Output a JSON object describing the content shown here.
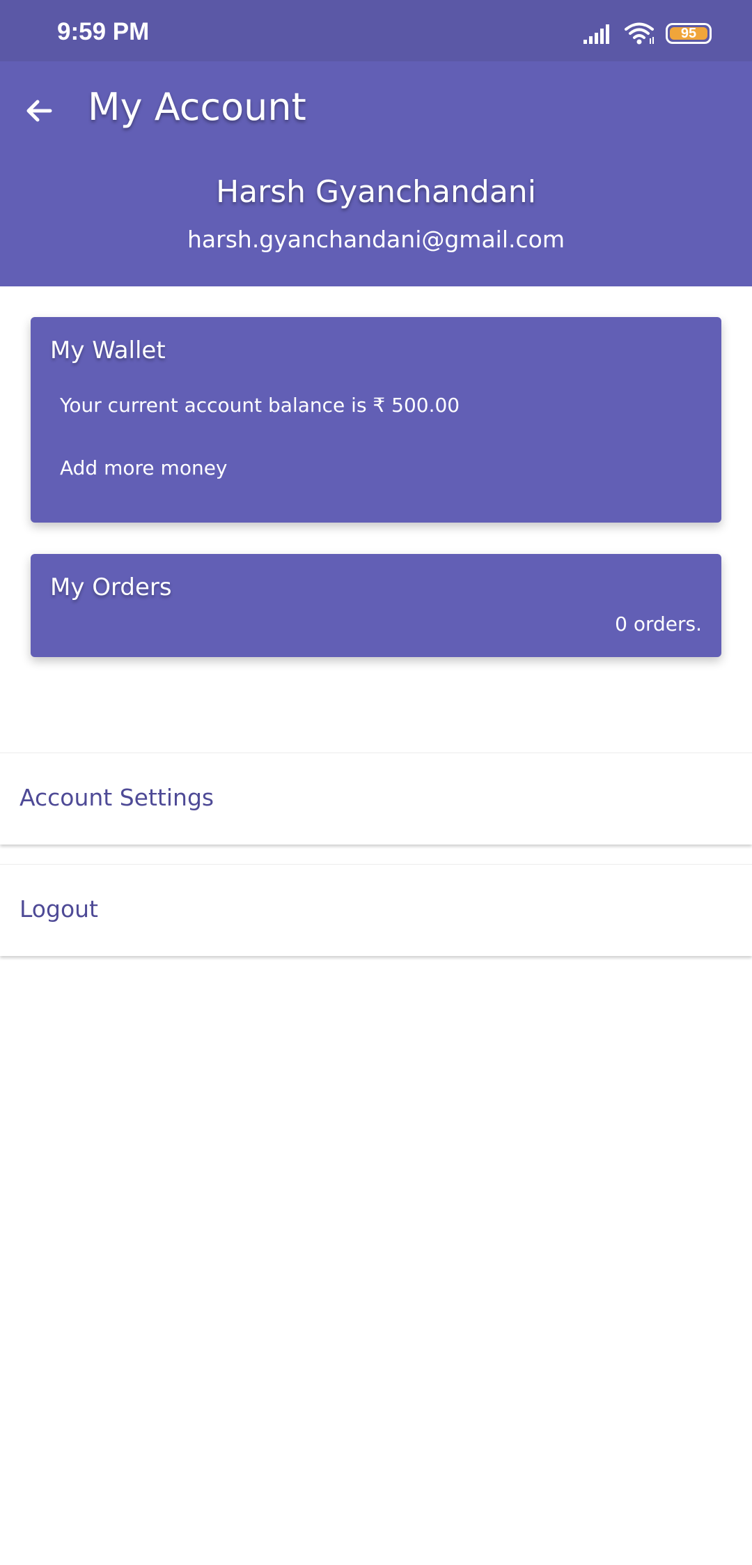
{
  "status_bar": {
    "time": "9:59 PM",
    "battery_level": "95",
    "icons": [
      "signal-icon",
      "wifi-icon",
      "battery-icon"
    ]
  },
  "header": {
    "title": "My Account",
    "back_icon": "arrow-back-icon"
  },
  "profile": {
    "name": "Harsh Gyanchandani",
    "email": "harsh.gyanchandani@gmail.com"
  },
  "wallet": {
    "title": "My Wallet",
    "balance_text": "Your current account balance is ₹ 500.00",
    "add_money_label": "Add more money"
  },
  "orders": {
    "title": "My Orders",
    "count_text": "0 orders."
  },
  "menu": {
    "items": [
      {
        "label": "Account Settings"
      },
      {
        "label": "Logout"
      }
    ]
  },
  "colors": {
    "status_bar": "#5b58a6",
    "primary": "#625fb5",
    "menu_text": "#4e4a96",
    "battery": "#f0a53a"
  }
}
